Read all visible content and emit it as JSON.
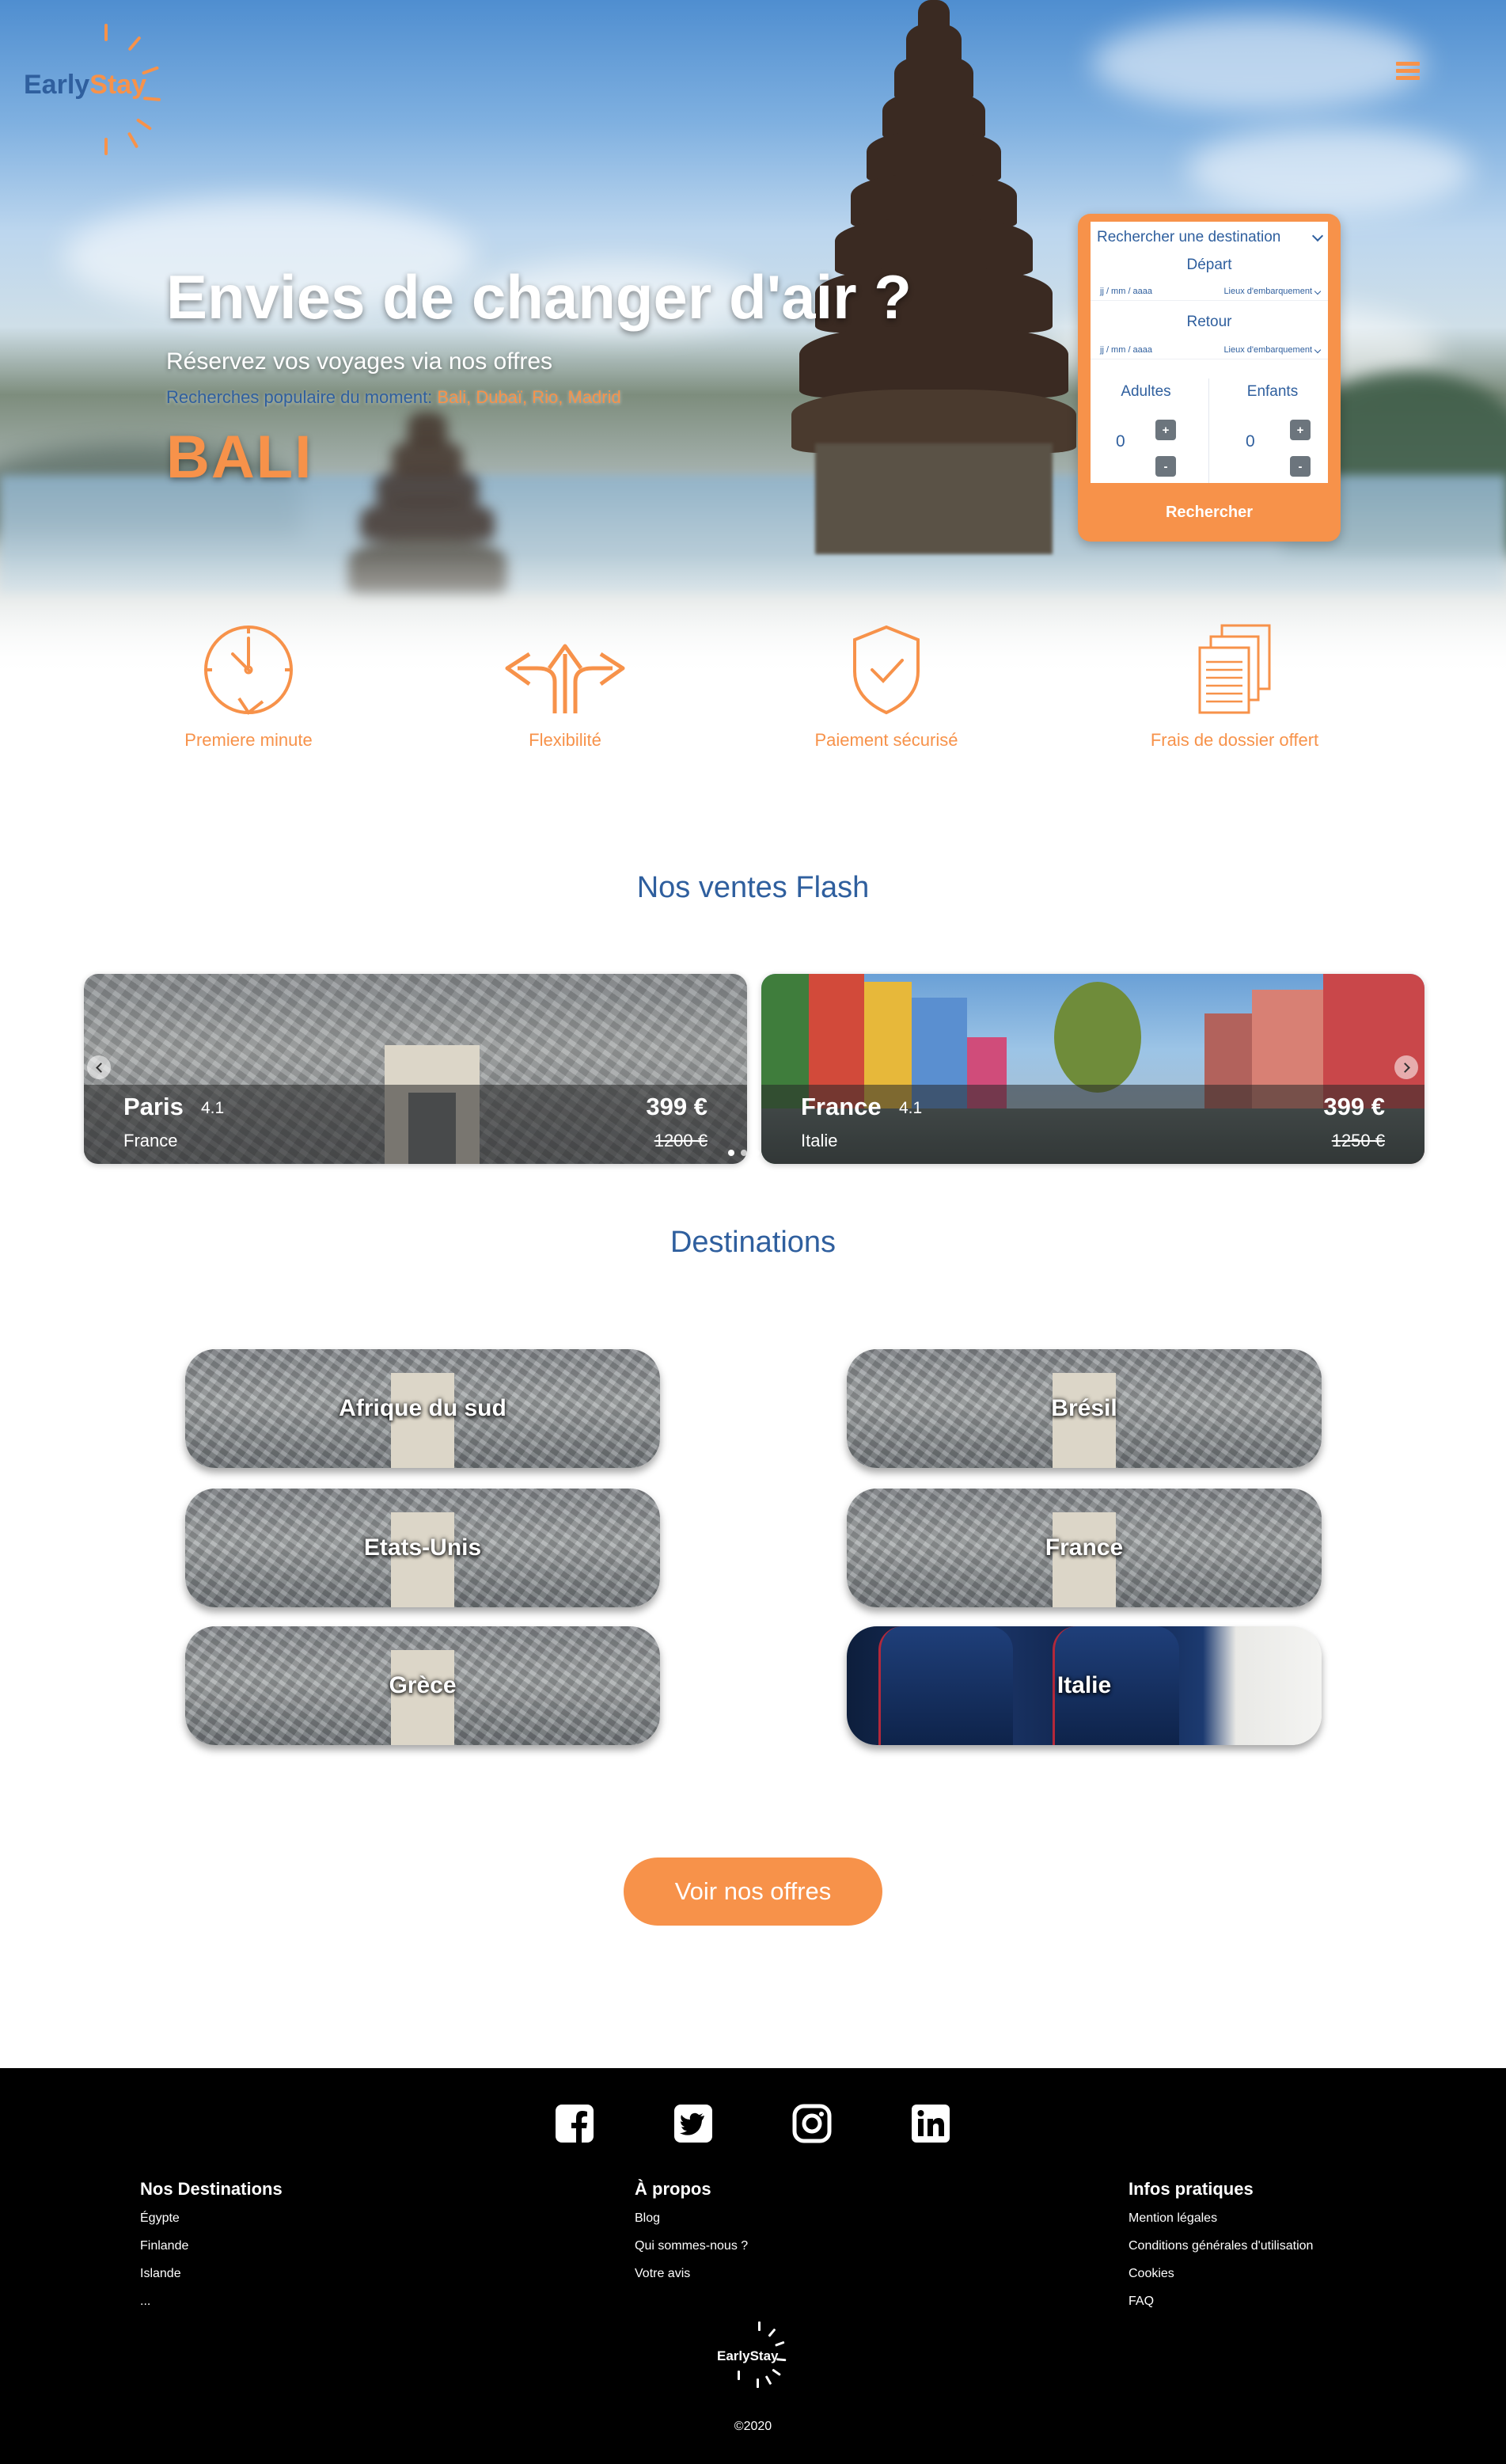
{
  "header": {
    "logo_early": "Early",
    "logo_stay": "Stay",
    "menu_icon": "hamburger-menu-icon"
  },
  "hero": {
    "title": "Envies de changer d'air ?",
    "subtitle": "Réservez vos voyages via nos offres",
    "popular_prefix": "Recherches populaire du moment:",
    "popular_cities": "Bali, Dubaï, Rio, Madrid",
    "highlight": "BALI"
  },
  "search": {
    "destination_placeholder": "Rechercher une destination",
    "depart_label": "Départ",
    "retour_label": "Retour",
    "date_placeholder": "jj / mm / aaaa",
    "place_placeholder": "Lieux d'embarquement",
    "adults_label": "Adultes",
    "children_label": "Enfants",
    "adults_value": "0",
    "children_value": "0",
    "plus": "+",
    "minus": "-",
    "submit": "Rechercher"
  },
  "features": [
    {
      "label": "Premiere minute",
      "icon": "clock-icon"
    },
    {
      "label": "Flexibilité",
      "icon": "split-arrows-icon"
    },
    {
      "label": "Paiement sécurisé",
      "icon": "shield-check-icon"
    },
    {
      "label": "Frais de dossier offert",
      "icon": "documents-icon"
    }
  ],
  "flash": {
    "title": "Nos ventes Flash",
    "cards": [
      {
        "city": "Paris",
        "rating": "4.1",
        "country": "France",
        "price": "399 €",
        "old_price": "1200 €"
      },
      {
        "city": "France",
        "rating": "4.1",
        "country": "Italie",
        "price": "399 €",
        "old_price": "1250 €"
      }
    ]
  },
  "destinations": {
    "title": "Destinations",
    "items": [
      "Afrique du sud",
      "Brésil",
      "Etats-Unis",
      "France",
      "Grèce",
      "Italie"
    ]
  },
  "cta": {
    "label": "Voir nos offres"
  },
  "footer": {
    "social": [
      "facebook-icon",
      "twitter-icon",
      "instagram-icon",
      "linkedin-icon"
    ],
    "columns": [
      {
        "title": "Nos Destinations",
        "links": [
          "Égypte",
          "Finlande",
          "Islande",
          "..."
        ]
      },
      {
        "title": "À propos",
        "links": [
          "Blog",
          "Qui sommes-nous ?",
          "Votre avis"
        ]
      },
      {
        "title": "Infos pratiques",
        "links": [
          "Mention légales",
          "Conditions générales d'utilisation",
          "Cookies",
          "FAQ"
        ]
      }
    ],
    "logo_text": "EarlyStay",
    "copyright": "©2020"
  },
  "colors": {
    "accent": "#f7924a",
    "primary": "#2f5f9e",
    "footer_bg": "#000000"
  }
}
